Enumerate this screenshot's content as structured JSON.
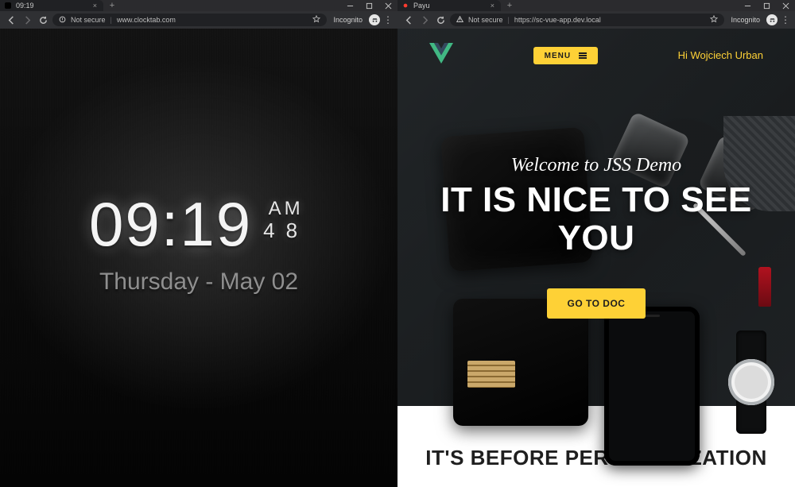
{
  "left_window": {
    "tab": {
      "title": "09:19",
      "close_glyph": "×"
    },
    "newtab_glyph": "+",
    "controls": [
      "min",
      "max",
      "close"
    ],
    "addr": {
      "not_secure": "Not secure",
      "url": "www.clocktab.com",
      "incognito": "Incognito"
    },
    "clock": {
      "time": "09:19",
      "ampm": "AM",
      "seconds": "48",
      "date": "Thursday - May 02"
    }
  },
  "right_window": {
    "tab": {
      "title": "Payu",
      "close_glyph": "×"
    },
    "newtab_glyph": "+",
    "controls": [
      "min",
      "max",
      "close"
    ],
    "addr": {
      "not_secure": "Not secure",
      "url": "https://sc-vue-app.dev.local",
      "incognito": "Incognito"
    },
    "site": {
      "menu_label": "MENU",
      "hello": "Hi Wojciech Urban",
      "welcome": "Welcome to JSS Demo",
      "title": "IT IS NICE TO SEE YOU",
      "cta": "GO TO DOC",
      "section_heading": "IT'S BEFORE PERSONALIZATION"
    }
  }
}
